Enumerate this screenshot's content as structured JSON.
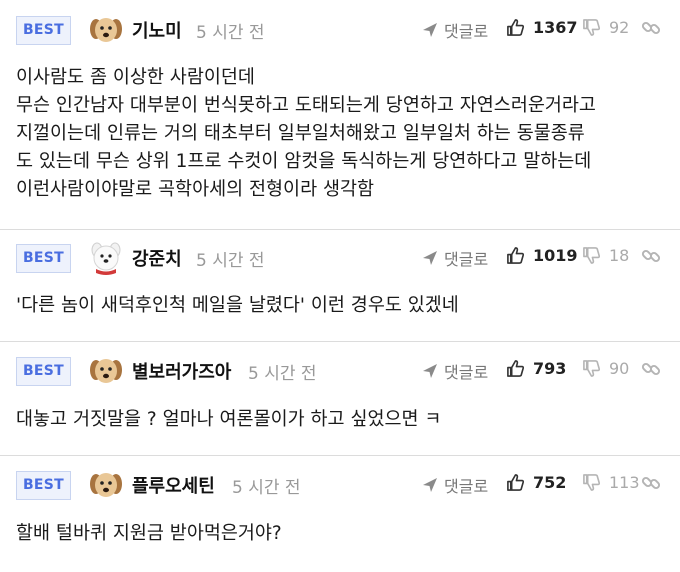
{
  "comments": [
    {
      "badge": "BEST",
      "nickname": "기노미",
      "time": "5 시간 전",
      "reply_label": "댓글로",
      "up_count": "1367",
      "down_count": "92",
      "avatar": "puppy-avatar",
      "body": [
        "이사람도 좀 이상한 사람이던데",
        "무슨 인간남자 대부분이 번식못하고 도태되는게 당연하고 자연스러운거라고",
        "지껄이는데 인류는 거의 태초부터 일부일처해왔고 일부일처 하는 동물종류",
        "도 있는데 무슨 상위 1프로 수컷이 암컷을 독식하는게 당연하다고 말하는데",
        "이런사람이야말로 곡학아세의 전형이라 생각함"
      ]
    },
    {
      "badge": "BEST",
      "nickname": "강준치",
      "time": "5 시간 전",
      "reply_label": "댓글로",
      "up_count": "1019",
      "down_count": "18",
      "avatar": "white-dog-avatar",
      "body": [
        "'다른 놈이 새덕후인척 메일을 날렸다' 이런 경우도 있겠네"
      ]
    },
    {
      "badge": "BEST",
      "nickname": "별보러가즈아",
      "time": "5 시간 전",
      "reply_label": "댓글로",
      "up_count": "793",
      "down_count": "90",
      "avatar": "puppy-avatar",
      "body": [
        "대놓고 거짓말을 ? 얼마나 여론몰이가 하고 싶었으면 ㅋ"
      ]
    },
    {
      "badge": "BEST",
      "nickname": "플루오세틴",
      "time": "5 시간 전",
      "reply_label": "댓글로",
      "up_count": "752",
      "down_count": "113",
      "avatar": "puppy-avatar",
      "body": [
        "할배 털바퀴 지원금 받아먹은거야?"
      ]
    }
  ],
  "colors": {
    "badge_text": "#4a6ee0",
    "badge_bg": "#eef2fc",
    "muted": "#999999",
    "divider": "#dcdcdc"
  }
}
